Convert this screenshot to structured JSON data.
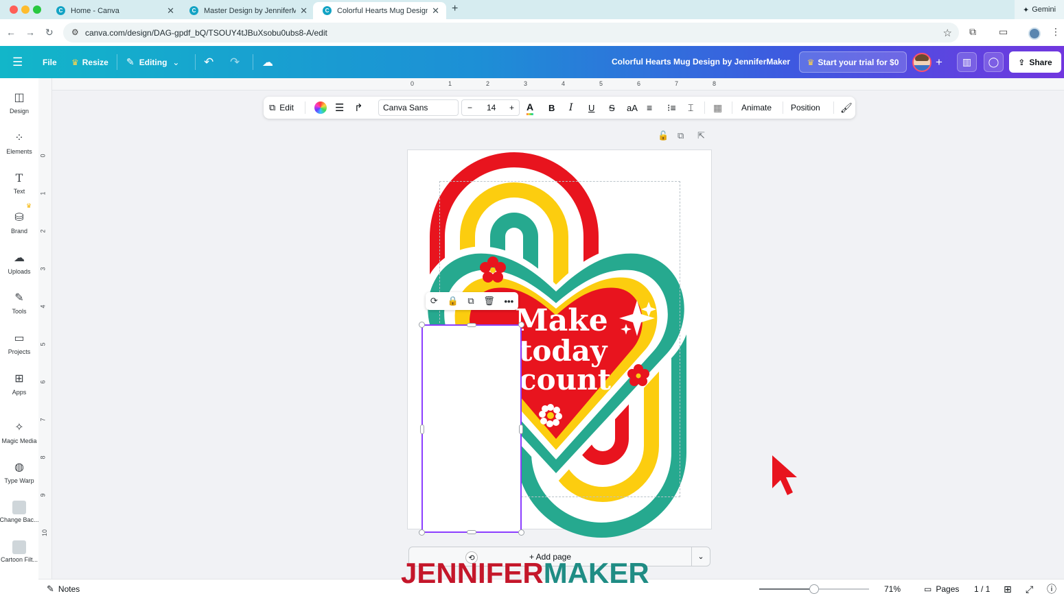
{
  "browser": {
    "tabs": [
      {
        "title": "Home - Canva",
        "active": false
      },
      {
        "title": "Master Design by JenniferMa",
        "active": false
      },
      {
        "title": "Colorful Hearts Mug Design b",
        "active": true
      }
    ],
    "new_tab": "+",
    "gemini_label": "Gemini",
    "url": "canva.com/design/DAG-gpdf_bQ/TSOUY4tJBuXsobu0ubs8-A/edit"
  },
  "canva_bar": {
    "file": "File",
    "resize": "Resize",
    "editing": "Editing",
    "doc_title": "Colorful Hearts Mug Design by JenniferMaker",
    "trial": "Start your trial for $0",
    "share": "Share"
  },
  "sidebar": {
    "items": [
      {
        "label": "Design",
        "icon": "design-icon"
      },
      {
        "label": "Elements",
        "icon": "elements-icon"
      },
      {
        "label": "Text",
        "icon": "text-icon"
      },
      {
        "label": "Brand",
        "icon": "brand-icon"
      },
      {
        "label": "Uploads",
        "icon": "uploads-icon"
      },
      {
        "label": "Tools",
        "icon": "tools-icon"
      },
      {
        "label": "Projects",
        "icon": "projects-icon"
      },
      {
        "label": "Apps",
        "icon": "apps-icon"
      },
      {
        "label": "Magic Media",
        "icon": "magic-media-icon"
      },
      {
        "label": "Type Warp",
        "icon": "type-warp-icon"
      },
      {
        "label": "Change Bac...",
        "icon": "change-background-icon"
      },
      {
        "label": "Cartoon Filt...",
        "icon": "cartoon-filter-icon"
      }
    ]
  },
  "ruler": {
    "top": [
      "0",
      "1",
      "2",
      "3",
      "4",
      "5",
      "6",
      "7",
      "8"
    ],
    "left": [
      "0",
      "1",
      "2",
      "3",
      "4",
      "5",
      "6",
      "7",
      "8",
      "9",
      "10"
    ]
  },
  "text_toolbar": {
    "edit": "Edit",
    "font": "Canva Sans",
    "size_minus": "−",
    "size": "14",
    "size_plus": "+",
    "bold": "B",
    "italic": "I",
    "underline": "U",
    "strike": "S",
    "case": "aA",
    "animate": "Animate",
    "position": "Position"
  },
  "design": {
    "text_lines": [
      "Make",
      "today",
      "count"
    ]
  },
  "add_page": "+ Add page",
  "bottom_bar": {
    "notes": "Notes",
    "zoom": "71%",
    "zoom_level": 0.5,
    "pages": "Pages",
    "page_count": "1 / 1"
  },
  "watermark": {
    "part1": "JENNIFER",
    "part2": "MAKER"
  },
  "colors": {
    "red": "#e8141e",
    "yellow": "#fccd0f",
    "teal": "#26a98f",
    "selection": "#8b3dff",
    "watermark_red": "#c4162a",
    "watermark_teal": "#1f8c84"
  }
}
